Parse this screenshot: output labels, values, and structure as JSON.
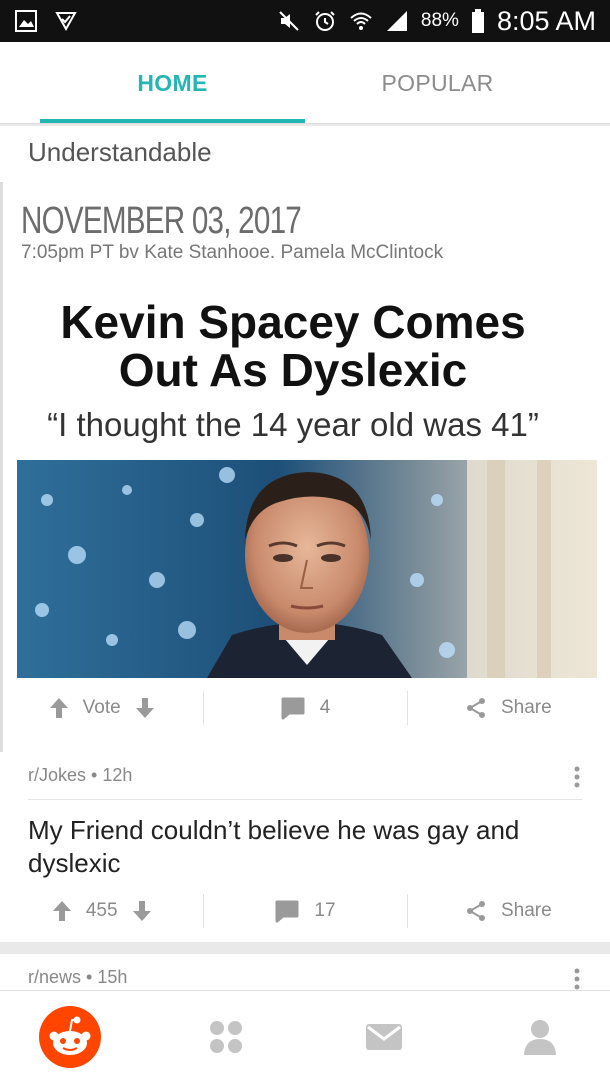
{
  "status_bar": {
    "battery": "88%",
    "time": "8:05 AM"
  },
  "tabs": [
    {
      "label": "HOME",
      "active": true
    },
    {
      "label": "POPULAR",
      "active": false
    }
  ],
  "posts": [
    {
      "title": "Understandable",
      "meme": {
        "date": "NOVEMBER 03, 2017",
        "byline": "7:05pm PT bv Kate Stanhooe. Pamela McClintock",
        "headline_line1": "Kevin Spacey Comes",
        "headline_line2": "Out As Dyslexic",
        "quote": "“I thought the 14 year old was 41”"
      },
      "vote_label": "Vote",
      "comments": "4",
      "share_label": "Share"
    },
    {
      "meta": "r/Jokes • 12h",
      "title": "My Friend couldn’t believe he was gay and dyslexic",
      "vote_label": "455",
      "comments": "17",
      "share_label": "Share"
    },
    {
      "meta": "r/news • 15h"
    }
  ],
  "colors": {
    "accent": "#24b6b2",
    "reddit_orange": "#ff4500",
    "status_bar": "#111111"
  },
  "icons": {
    "nav": [
      "reddit-home-icon",
      "communities-icon",
      "inbox-icon",
      "profile-icon"
    ]
  }
}
